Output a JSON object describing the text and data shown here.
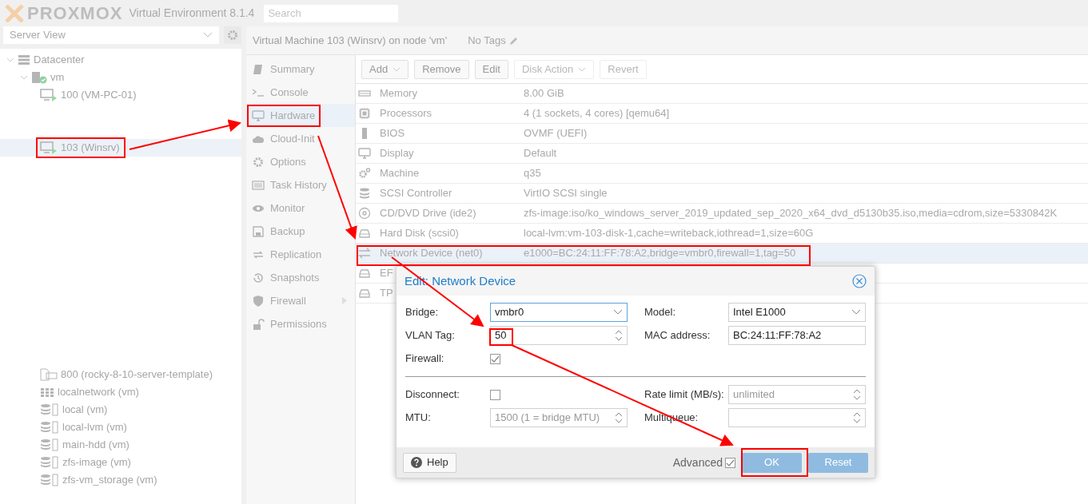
{
  "header": {
    "logo": "PROXMOX",
    "product": "Virtual Environment 8.1.4",
    "search": {
      "placeholder": "Search"
    }
  },
  "tree_panel": {
    "view": "Server View",
    "items": [
      {
        "kind": "datacenter",
        "label": "Datacenter",
        "expanded": true,
        "selected": false,
        "children": [
          {
            "kind": "node",
            "label": "vm",
            "expanded": true,
            "selected": false,
            "children": [
              {
                "kind": "vm",
                "label": "100 (VM-PC-01)",
                "selected": false
              },
              {
                "kind": "vm",
                "label": "103 (Winsrv)",
                "selected": true
              },
              {
                "kind": "template",
                "label": "800 (rocky-8-10-server-template)",
                "selected": false
              },
              {
                "kind": "network",
                "label": "localnetwork (vm)",
                "selected": false
              },
              {
                "kind": "storage",
                "label": "local (vm)",
                "selected": false
              },
              {
                "kind": "storage",
                "label": "local-lvm (vm)",
                "selected": false
              },
              {
                "kind": "storage",
                "label": "main-hdd (vm)",
                "selected": false
              },
              {
                "kind": "storage",
                "label": "zfs-image (vm)",
                "selected": false
              },
              {
                "kind": "storage",
                "label": "zfs-vm_storage (vm)",
                "selected": false
              }
            ]
          }
        ]
      }
    ]
  },
  "content": {
    "title": "Virtual Machine 103 (Winsrv) on node 'vm'",
    "tags": "No Tags",
    "nav": [
      {
        "kind": "book",
        "label": "Summary",
        "selected": false
      },
      {
        "kind": "terminal",
        "label": "Console",
        "selected": false
      },
      {
        "kind": "monitor",
        "label": "Hardware",
        "selected": true
      },
      {
        "kind": "cloud",
        "label": "Cloud-Init",
        "selected": false
      },
      {
        "kind": "gear",
        "label": "Options",
        "selected": false
      },
      {
        "kind": "list",
        "label": "Task History",
        "selected": false
      },
      {
        "kind": "eye",
        "label": "Monitor",
        "selected": false
      },
      {
        "kind": "floppy",
        "label": "Backup",
        "selected": false
      },
      {
        "kind": "replication",
        "label": "Replication",
        "selected": false
      },
      {
        "kind": "history",
        "label": "Snapshots",
        "selected": false
      },
      {
        "kind": "shield",
        "label": "Firewall",
        "selected": false,
        "submenu": true
      },
      {
        "kind": "unlock",
        "label": "Permissions",
        "selected": false
      }
    ],
    "toolbar": [
      {
        "label": "Add",
        "dropdown": true,
        "disabled": false
      },
      {
        "label": "Remove",
        "dropdown": false,
        "disabled": false
      },
      {
        "label": "Edit",
        "dropdown": false,
        "disabled": false
      },
      {
        "label": "Disk Action",
        "dropdown": true,
        "disabled": true
      },
      {
        "label": "Revert",
        "dropdown": false,
        "disabled": true
      }
    ],
    "hardware": [
      {
        "kind": "memory",
        "name": "Memory",
        "value": "8.00 GiB",
        "selected": false
      },
      {
        "kind": "cpu",
        "name": "Processors",
        "value": "4 (1 sockets, 4 cores) [qemu64]",
        "selected": false
      },
      {
        "kind": "chip",
        "name": "BIOS",
        "value": "OVMF (UEFI)",
        "selected": false
      },
      {
        "kind": "monitor",
        "name": "Display",
        "value": "Default",
        "selected": false
      },
      {
        "kind": "gears",
        "name": "Machine",
        "value": "q35",
        "selected": false
      },
      {
        "kind": "database",
        "name": "SCSI Controller",
        "value": "VirtIO SCSI single",
        "selected": false
      },
      {
        "kind": "disc",
        "name": "CD/DVD Drive (ide2)",
        "value": "zfs-image:iso/ko_windows_server_2019_updated_sep_2020_x64_dvd_d5130b35.iso,media=cdrom,size=5330842K",
        "selected": false
      },
      {
        "kind": "hdd",
        "name": "Hard Disk (scsi0)",
        "value": "local-lvm:vm-103-disk-1,cache=writeback,iothread=1,size=60G",
        "selected": false
      },
      {
        "kind": "exchange",
        "name": "Network Device (net0)",
        "value": "e1000=BC:24:11:FF:78:A2,bridge=vmbr0,firewall=1,tag=50",
        "selected": true
      },
      {
        "kind": "hdd",
        "name": "EF",
        "selected": false
      },
      {
        "kind": "hdd",
        "name": "TP",
        "selected": false
      }
    ]
  },
  "dialog": {
    "title": "Edit: Network Device",
    "left_fields": [
      {
        "kind": "select",
        "label": "Bridge:",
        "value": "vmbr0",
        "focused": true
      },
      {
        "kind": "spin",
        "label": "VLAN Tag:",
        "value": "50",
        "focused": false
      },
      {
        "kind": "checkbox",
        "label": "Firewall:",
        "checked": true
      }
    ],
    "right_fields": [
      {
        "kind": "select",
        "label": "Model:",
        "value": "Intel E1000",
        "focused": false
      },
      {
        "kind": "text",
        "label": "MAC address:",
        "value": "BC:24:11:FF:78:A2",
        "focused": false
      }
    ],
    "advanced_left": [
      {
        "kind": "checkbox",
        "label": "Disconnect:",
        "checked": false
      },
      {
        "kind": "spin",
        "label": "MTU:",
        "placeholder": "1500 (1 = bridge MTU)",
        "focused": false
      }
    ],
    "advanced_right": [
      {
        "kind": "spin",
        "label": "Rate limit (MB/s):",
        "placeholder": "unlimited",
        "focused": false
      },
      {
        "kind": "spin",
        "label": "Multiqueue:",
        "focused": false
      }
    ],
    "help": "Help",
    "advanced": {
      "label": "Advanced",
      "checked": true
    },
    "buttons": [
      {
        "label": "OK"
      },
      {
        "label": "Reset"
      }
    ]
  }
}
